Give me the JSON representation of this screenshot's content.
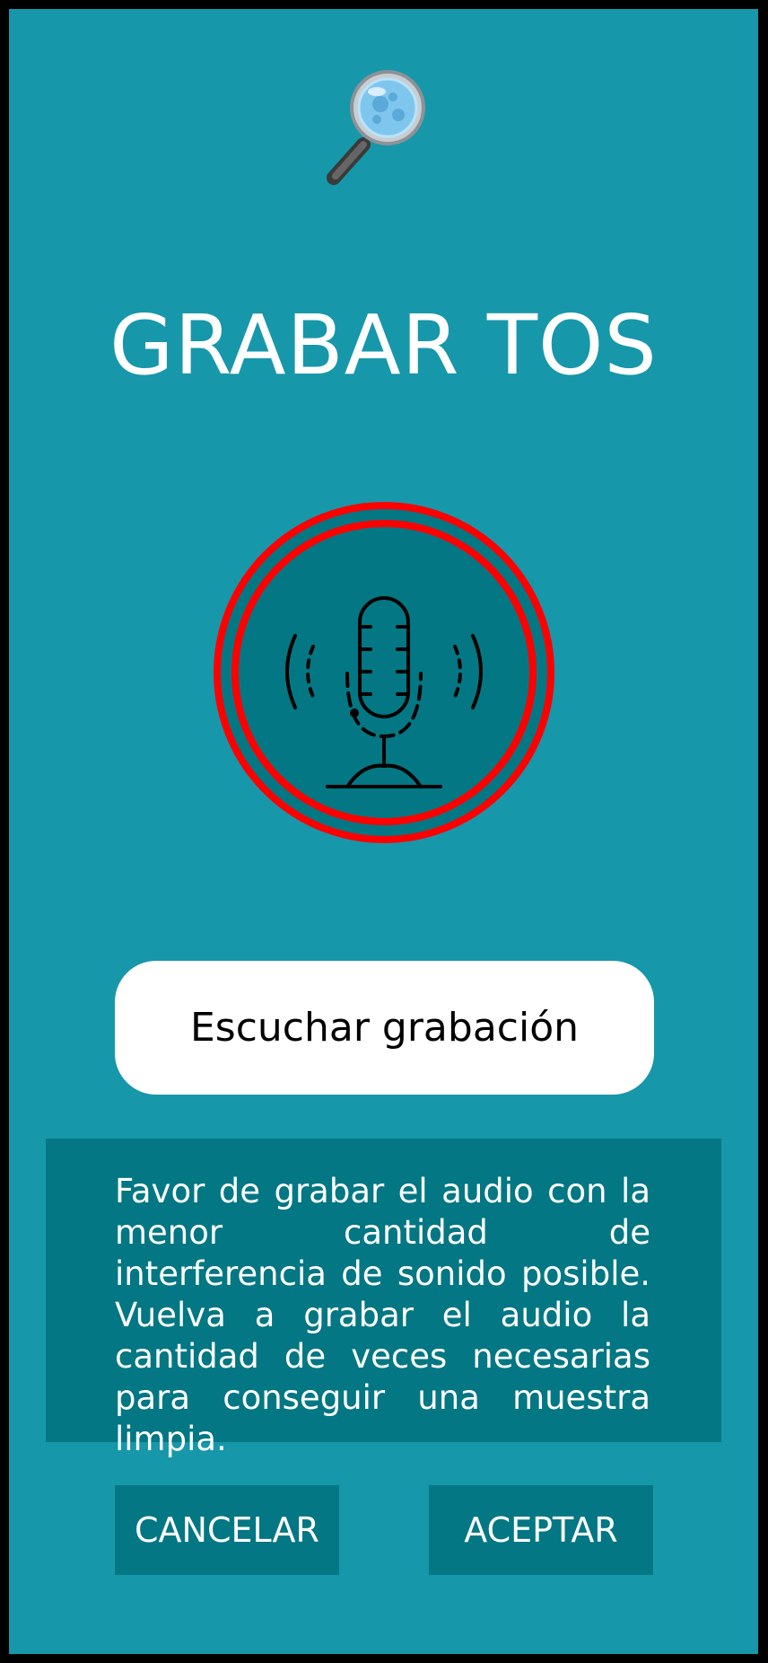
{
  "header": {
    "logo_icon": "magnifier-virus-icon",
    "title": "GRABAR TOS"
  },
  "record": {
    "icon": "microphone-icon",
    "ring_color": "#ff0000",
    "fill_color": "#037783"
  },
  "listen_button": {
    "label": "Escuchar grabación"
  },
  "info": {
    "text": "Favor de grabar el audio con la menor cantidad de interferencia de sonido posible. Vuelva a grabar el audio la cantidad de veces necesarias para conseguir una muestra limpia."
  },
  "actions": {
    "cancel_label": "CANCELAR",
    "accept_label": "ACEPTAR"
  },
  "colors": {
    "background": "#1797aa",
    "panel": "#037783",
    "frame": "#000000"
  }
}
